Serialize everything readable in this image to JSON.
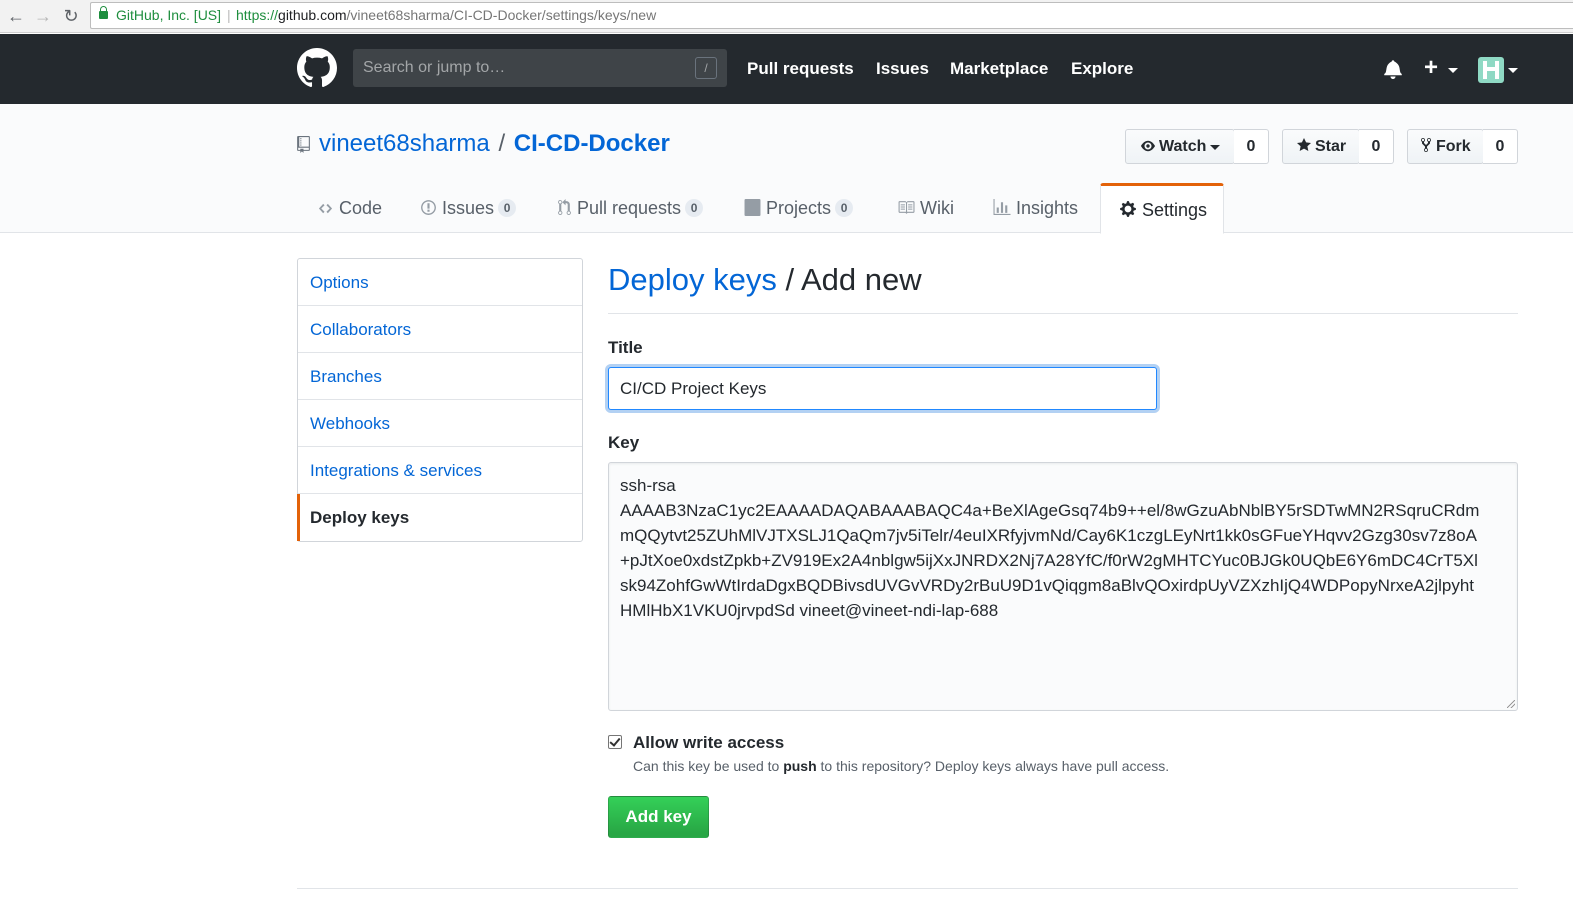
{
  "browser": {
    "back_icon": "←",
    "forward_icon": "→",
    "reload_icon": "↻",
    "site_identity": "GitHub, Inc. [US]",
    "omni_separator": "|",
    "url_scheme": "https://",
    "url_host": "github.com",
    "url_path": "/vineet68sharma/CI-CD-Docker/settings/keys/new"
  },
  "header": {
    "search_placeholder": "Search or jump to…",
    "search_shortcut": "/",
    "nav": [
      "Pull requests",
      "Issues",
      "Marketplace",
      "Explore"
    ],
    "plus_symbol": "+",
    "colors": {
      "bg": "#24292e",
      "search_bg": "#3f4448"
    }
  },
  "repo": {
    "owner": "vineet68sharma",
    "separator": "/",
    "name": "CI-CD-Docker",
    "actions": [
      {
        "label": "Watch",
        "count": "0",
        "icon": "eye-icon"
      },
      {
        "label": "Star",
        "count": "0",
        "icon": "star-icon"
      },
      {
        "label": "Fork",
        "count": "0",
        "icon": "fork-icon"
      }
    ],
    "tabs": [
      {
        "label": "Code",
        "icon": "code-icon"
      },
      {
        "label": "Issues",
        "count": "0",
        "icon": "issue-icon"
      },
      {
        "label": "Pull requests",
        "count": "0",
        "icon": "pull-request-icon"
      },
      {
        "label": "Projects",
        "count": "0",
        "icon": "project-icon"
      },
      {
        "label": "Wiki",
        "icon": "book-icon"
      },
      {
        "label": "Insights",
        "icon": "graph-icon"
      },
      {
        "label": "Settings",
        "icon": "gear-icon",
        "selected": true
      }
    ]
  },
  "sidebar": {
    "items": [
      {
        "label": "Options"
      },
      {
        "label": "Collaborators"
      },
      {
        "label": "Branches"
      },
      {
        "label": "Webhooks"
      },
      {
        "label": "Integrations & services"
      },
      {
        "label": "Deploy keys",
        "selected": true
      }
    ],
    "accent": "#e36209"
  },
  "form": {
    "breadcrumb": "Deploy keys",
    "breadcrumb_sep": " / ",
    "heading": "Add new",
    "title_label": "Title",
    "title_value": "CI/CD Project Keys",
    "key_label": "Key",
    "key_lines": [
      "ssh-rsa",
      "AAAAB3NzaC1yc2EAAAADAQABAAABAQC4a+BeXlAgeGsq74b9++el/8wGzuAbNblBY5rSDTwMN2RSqruCRdm",
      "mQQytvt25ZUhMlVJTXSLJ1QaQm7jv5iTelr/4euIXRfyjvmNd/Cay6K1czgLEyNrt1kk0sGFueYHqvv2Gzg30sv7z8oA",
      "+pJtXoe0xdstZpkb+ZV919Ex2A4nblgw5ijXxJNRDX2Nj7A28YfC/f0rW2gMHTCYuc0BJGk0UQbE6Y6mDC4CrT5Xl",
      "sk94ZohfGwWtIrdaDgxBQDBivsdUVGvVRDy2rBuU9D1vQiqgm8aBlvQOxirdpUyVZXzhIjQ4WDPopyNrxeA2jlpyht",
      "HMlHbX1VKU0jrvpdSd vineet@vineet-ndi-lap-688"
    ],
    "allow_write_label": "Allow write access",
    "allow_write_checked": true,
    "note_before": "Can this key be used to ",
    "note_bold": "push",
    "note_after": " to this repository? Deploy keys always have pull access.",
    "submit_label": "Add key",
    "colors": {
      "link": "#0366d6",
      "button": "#28a745"
    }
  }
}
